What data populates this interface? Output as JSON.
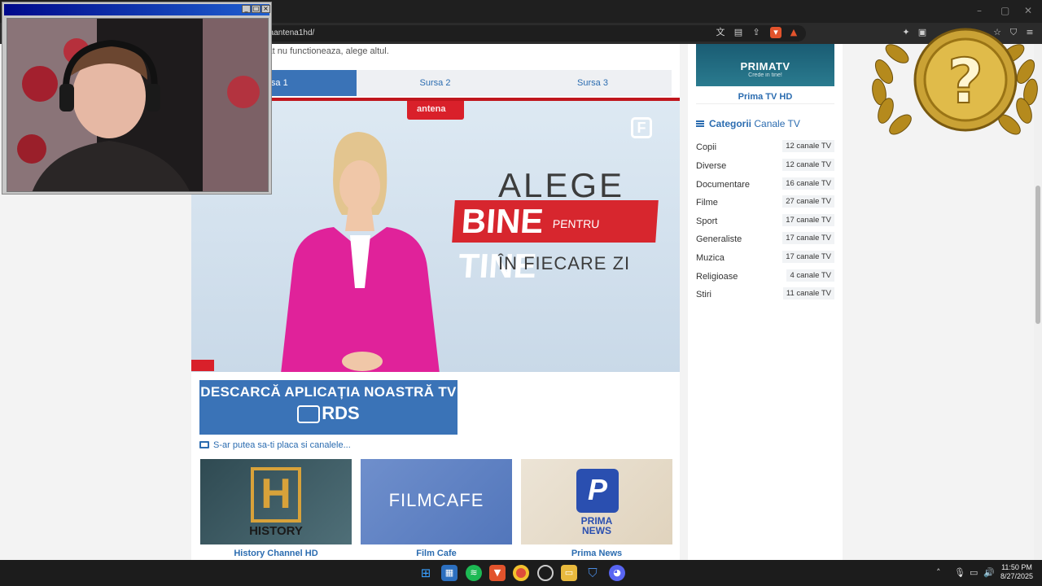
{
  "browser": {
    "url": "maniaantena1hd/",
    "window_controls": {
      "minimize": "–",
      "maximize": "▢",
      "close": "✕"
    }
  },
  "page": {
    "notice": "ctat nu functioneaza, alege altul.",
    "tabs": [
      {
        "label": "rsa 1",
        "active": true
      },
      {
        "label": "Sursa 2",
        "active": false
      },
      {
        "label": "Sursa 3",
        "active": false
      }
    ],
    "video": {
      "channel_logo": "antena",
      "line1": "ALEGE",
      "line2_a": "BINE",
      "line2_b": "PENTRU",
      "line2_c": "TINE",
      "line3": "ÎN FIECARE ZI"
    },
    "banner": {
      "title": "DESCARCĂ APLICAȚIA NOASTRĂ TV",
      "brand": "RDS"
    },
    "suggest_text": "S-ar putea sa-ti placa si canalele...",
    "cards": [
      {
        "name": "History Channel HD",
        "logo": "HISTORY"
      },
      {
        "name": "Film Cafe",
        "logo": "FILMCAFE"
      },
      {
        "name": "Prima News",
        "logo": "PRIMA NEWS"
      }
    ]
  },
  "sidebar": {
    "top_channel": {
      "logo": "PRIMATV",
      "tagline": "Crede in tine!",
      "name": "Prima TV HD"
    },
    "categories_title_bold": "Categorii",
    "categories_title_rest": "Canale TV",
    "categories": [
      {
        "name": "Copii",
        "count": "12 canale TV"
      },
      {
        "name": "Diverse",
        "count": "12 canale TV"
      },
      {
        "name": "Documentare",
        "count": "16 canale TV"
      },
      {
        "name": "Filme",
        "count": "27 canale TV"
      },
      {
        "name": "Sport",
        "count": "17 canale TV"
      },
      {
        "name": "Generaliste",
        "count": "17 canale TV"
      },
      {
        "name": "Muzica",
        "count": "17 canale TV"
      },
      {
        "name": "Religioase",
        "count": "4 canale TV"
      },
      {
        "name": "Stiri",
        "count": "11 canale TV"
      }
    ]
  },
  "overlay": {
    "badge_symbol": "?"
  },
  "taskbar": {
    "time": "11:50 PM",
    "date": "8/27/2025"
  },
  "colors": {
    "accent": "#3a73b7",
    "link": "#2b6cb0",
    "red": "#d7262e"
  }
}
